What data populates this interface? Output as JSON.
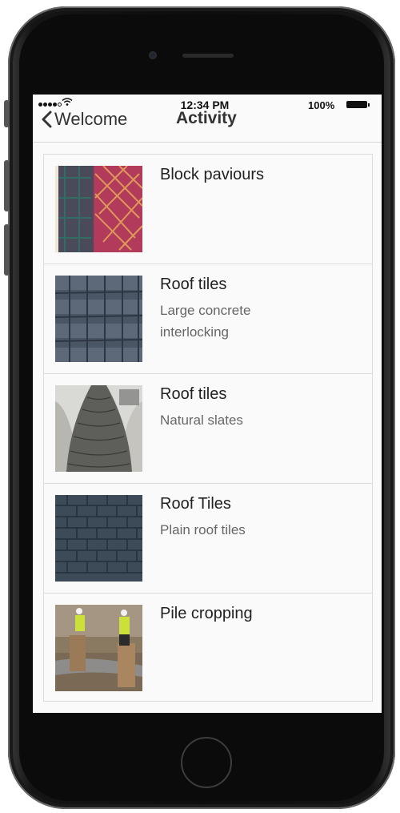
{
  "status_bar": {
    "time": "12:34 PM",
    "battery": "100%"
  },
  "nav": {
    "back_label": "Welcome",
    "title": "Activity"
  },
  "items": [
    {
      "title": "Block paviours",
      "subtitle": ""
    },
    {
      "title": "Roof tiles",
      "subtitle": "Large concrete interlocking"
    },
    {
      "title": "Roof tiles",
      "subtitle": "Natural slates"
    },
    {
      "title": "Roof Tiles",
      "subtitle": "Plain roof tiles"
    },
    {
      "title": "Pile cropping",
      "subtitle": ""
    }
  ]
}
